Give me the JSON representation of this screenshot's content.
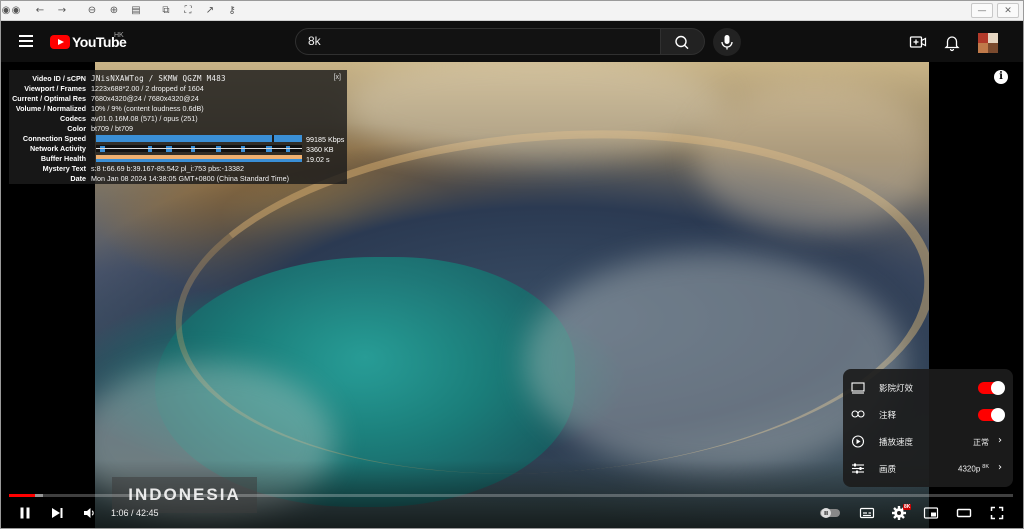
{
  "browser": {
    "toolbar_icons": [
      "close-circle",
      "close-circle",
      "back-arrow",
      "forward-arrow",
      "zoom-out",
      "zoom-in",
      "reader-view",
      "copy",
      "fullscreen-frame",
      "open-external",
      "key"
    ]
  },
  "header": {
    "logo_text": "YouTube",
    "region": "HK",
    "search_value": "8k"
  },
  "stats": {
    "close_label": "[x]",
    "rows": [
      {
        "label": "Video ID / sCPN",
        "value": "JNisNXAWTog / SKMW QGZM M483"
      },
      {
        "label": "Viewport / Frames",
        "value": "1223x688*2.00 / 2 dropped of 1604"
      },
      {
        "label": "Current / Optimal Res",
        "value": "7680x4320@24 / 7680x4320@24"
      },
      {
        "label": "Volume / Normalized",
        "value": "10% / 9% (content loudness 0.6dB)"
      },
      {
        "label": "Codecs",
        "value": "av01.0.16M.08 (571) / opus (251)"
      },
      {
        "label": "Color",
        "value": "bt709 / bt709"
      },
      {
        "label": "Connection Speed",
        "value": "99185 Kbps"
      },
      {
        "label": "Network Activity",
        "value": "3360 KB"
      },
      {
        "label": "Buffer Health",
        "value": "19.02 s"
      },
      {
        "label": "Mystery Text",
        "value": "s:8 t:66.69 b:39.167-85.542 pl_i:753 pbs:-13382"
      },
      {
        "label": "Date",
        "value": "Mon Jan 08 2024 14:38:05 GMT+0800 (China Standard Time)"
      }
    ]
  },
  "settings": {
    "items": [
      {
        "label": "影院灯效",
        "icon": "ambient-mode-icon",
        "toggle": true
      },
      {
        "label": "注释",
        "icon": "annotations-icon",
        "toggle": true
      },
      {
        "label": "播放速度",
        "icon": "playback-speed-icon",
        "value": "正常"
      },
      {
        "label": "画质",
        "icon": "quality-icon",
        "value": "4320p",
        "badge": "8K"
      }
    ]
  },
  "video": {
    "location_text": "INDONESIA",
    "current_time": "1:06",
    "duration": "42:45",
    "time_display": "1:06 / 42:45",
    "hd_badge": "8K",
    "progress_fraction": 0.026,
    "buffer_fraction": 0.034
  },
  "colors": {
    "brand_red": "#ff0000",
    "bar_blue": "#3a8fd6",
    "buffer_orange": "#f0b070"
  }
}
